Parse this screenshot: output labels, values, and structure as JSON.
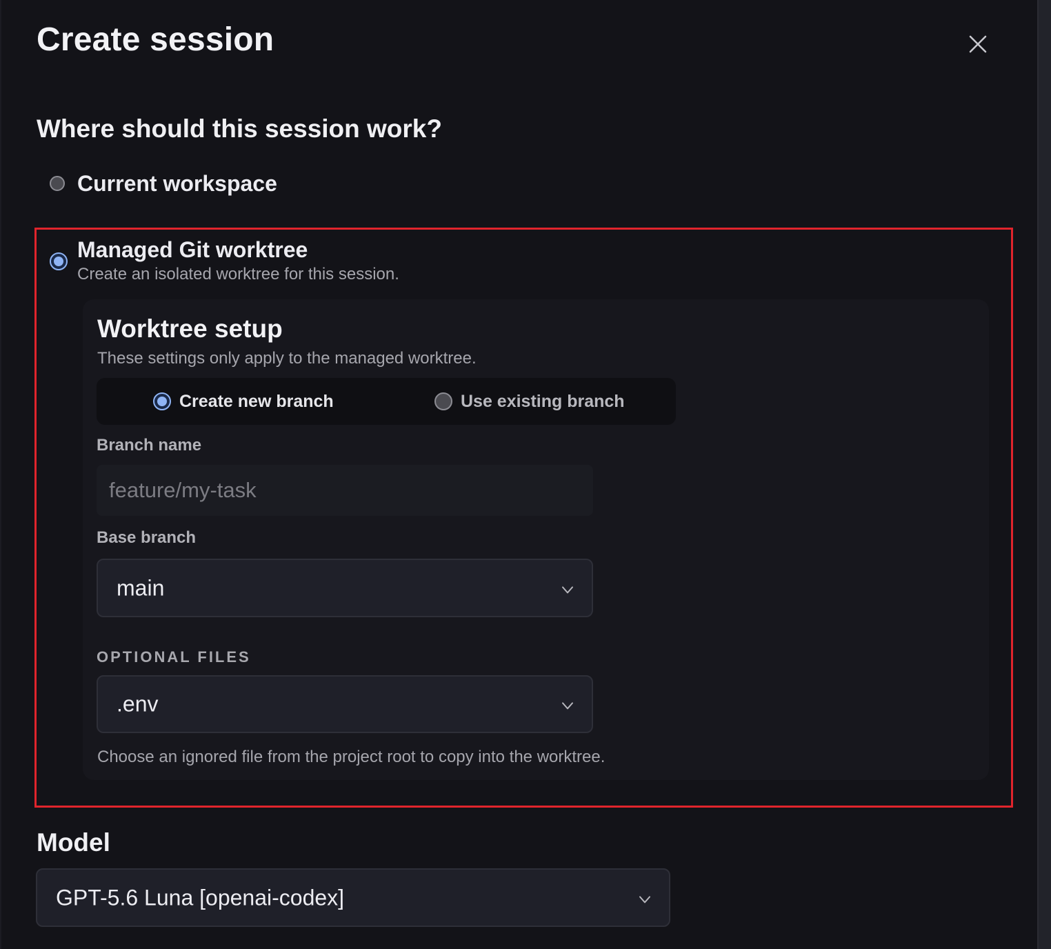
{
  "dialog": {
    "title": "Create session",
    "close_icon": "close-icon"
  },
  "location": {
    "heading": "Where should this session work?",
    "options": [
      {
        "label": "Current workspace",
        "selected": false
      },
      {
        "label": "Managed Git worktree",
        "description": "Create an isolated worktree for this session.",
        "selected": true
      }
    ]
  },
  "worktree_setup": {
    "title": "Worktree setup",
    "description": "These settings only apply to the managed worktree.",
    "branch_mode": {
      "options": [
        {
          "label": "Create new branch",
          "selected": true
        },
        {
          "label": "Use existing branch",
          "selected": false
        }
      ]
    },
    "branch_name": {
      "label": "Branch name",
      "value": "",
      "placeholder": "feature/my-task"
    },
    "base_branch": {
      "label": "Base branch",
      "selected": "main",
      "icon": "chevron-down-icon"
    },
    "optional_files": {
      "label": "OPTIONAL FILES",
      "selected": ".env",
      "icon": "chevron-down-icon",
      "help": "Choose an ignored file from the project root to copy into the worktree."
    }
  },
  "model": {
    "heading": "Model",
    "selected": "GPT-5.6 Luna [openai-codex]",
    "icon": "chevron-down-icon"
  },
  "colors": {
    "background": "#131318",
    "panel": "#17171d",
    "accent": "#8fb4f5",
    "highlight_border": "#e0242c"
  }
}
